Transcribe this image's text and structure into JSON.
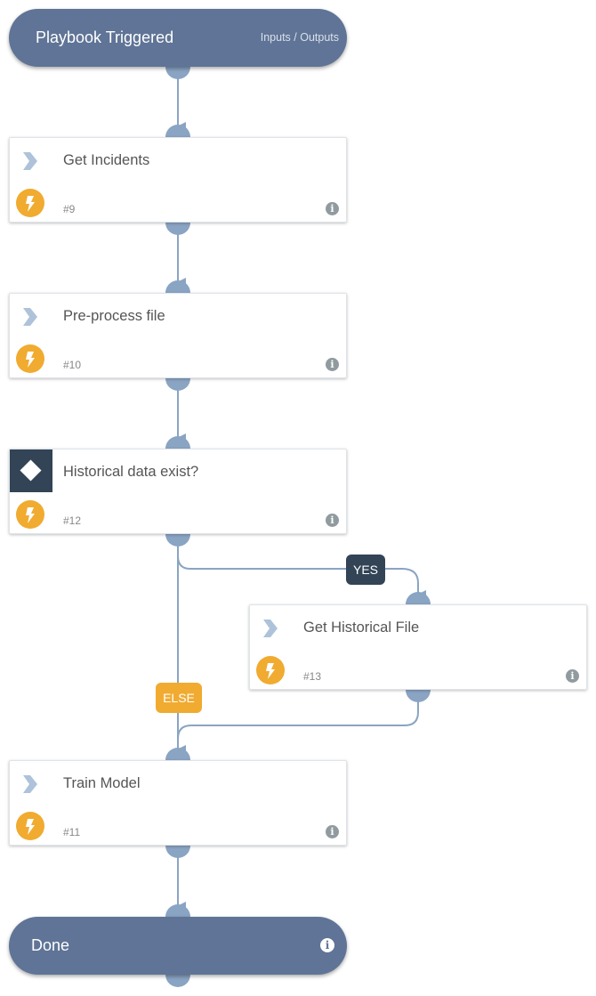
{
  "start": {
    "title": "Playbook Triggered",
    "io_link": "Inputs / Outputs"
  },
  "tasks": [
    {
      "name": "Get Incidents",
      "id": "#9",
      "type": "automation"
    },
    {
      "name": "Pre-process file",
      "id": "#10",
      "type": "automation"
    },
    {
      "name": "Historical data exist?",
      "id": "#12",
      "type": "condition"
    },
    {
      "name": "Get Historical File",
      "id": "#13",
      "type": "automation"
    },
    {
      "name": "Train Model",
      "id": "#11",
      "type": "automation"
    }
  ],
  "branches": {
    "yes": "YES",
    "else": "ELSE"
  },
  "end": {
    "title": "Done",
    "info": "i"
  },
  "info_glyph": "i",
  "colors": {
    "pill": "#5f7496",
    "connector": "#8aa4c3",
    "condition": "#324456",
    "bolt": "#f0ab30",
    "info": "#919b9f"
  }
}
